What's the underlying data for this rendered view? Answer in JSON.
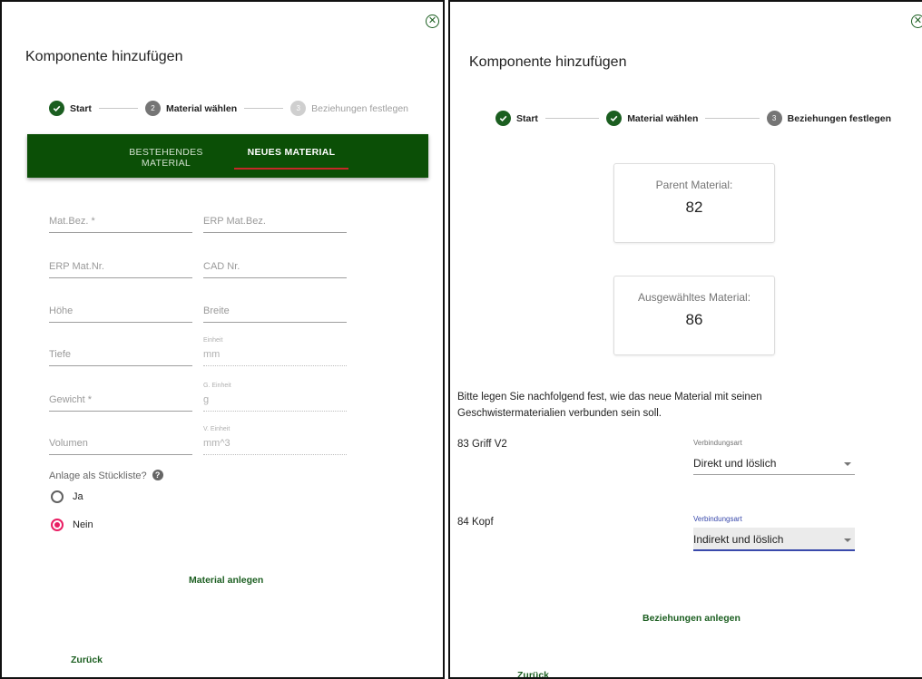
{
  "left_dialog": {
    "title": "Komponente hinzufügen",
    "close_icon": "close-circle-icon",
    "steps": [
      {
        "label": "Start",
        "state": "done",
        "number": ""
      },
      {
        "label": "Material wählen",
        "state": "active",
        "number": "2"
      },
      {
        "label": "Beziehungen festlegen",
        "state": "todo",
        "number": "3"
      }
    ],
    "tabs": [
      {
        "label": "BESTEHENDES MATERIAL",
        "active": false
      },
      {
        "label": "NEUES MATERIAL",
        "active": true
      }
    ],
    "fields": {
      "mat_bez": {
        "placeholder": "Mat.Bez. *"
      },
      "erp_mat_bez": {
        "placeholder": "ERP Mat.Bez."
      },
      "erp_mat_nr": {
        "placeholder": "ERP Mat.Nr."
      },
      "cad_nr": {
        "placeholder": "CAD Nr."
      },
      "hoehe": {
        "placeholder": "Höhe"
      },
      "breite": {
        "placeholder": "Breite"
      },
      "tiefe": {
        "placeholder": "Tiefe"
      },
      "einheit": {
        "label": "Einheit",
        "value": "mm"
      },
      "gewicht": {
        "placeholder": "Gewicht *"
      },
      "g_einheit": {
        "label": "G. Einheit",
        "value": "g"
      },
      "volumen": {
        "placeholder": "Volumen"
      },
      "v_einheit": {
        "label": "V. Einheit",
        "value": "mm^3"
      }
    },
    "stueckliste": {
      "question": "Anlage als Stückliste?",
      "help_icon": "help-icon",
      "options": [
        {
          "label": "Ja",
          "checked": false
        },
        {
          "label": "Nein",
          "checked": true
        }
      ]
    },
    "submit_label": "Material anlegen",
    "back_label": "Zurück"
  },
  "right_dialog": {
    "title": "Komponente hinzufügen",
    "close_icon": "close-circle-icon",
    "steps": [
      {
        "label": "Start",
        "state": "done",
        "number": ""
      },
      {
        "label": "Material wählen",
        "state": "done",
        "number": ""
      },
      {
        "label": "Beziehungen festlegen",
        "state": "active",
        "number": "3"
      }
    ],
    "parent_card": {
      "label": "Parent Material:",
      "value": "82"
    },
    "selected_card": {
      "label": "Ausgewähltes Material:",
      "value": "86"
    },
    "description": "Bitte legen Sie nachfolgend fest, wie das neue Material mit seinen Geschwistermaterialien verbunden sein soll.",
    "relations": [
      {
        "name": "83 Griff V2",
        "select_label": "Verbindungsart",
        "select_value": "Direkt und löslich",
        "focused": false
      },
      {
        "name": "84 Kopf",
        "select_label": "Verbindungsart",
        "select_value": "Indirekt und löslich",
        "focused": true
      }
    ],
    "submit_label": "Beziehungen anlegen",
    "back_label": "Zurück"
  },
  "colors": {
    "primary_green": "#0b4f06",
    "link_green": "#1b5e20",
    "tab_indicator": "#c62828",
    "radio_accent": "#e91e63",
    "focus_blue": "#3949ab"
  }
}
